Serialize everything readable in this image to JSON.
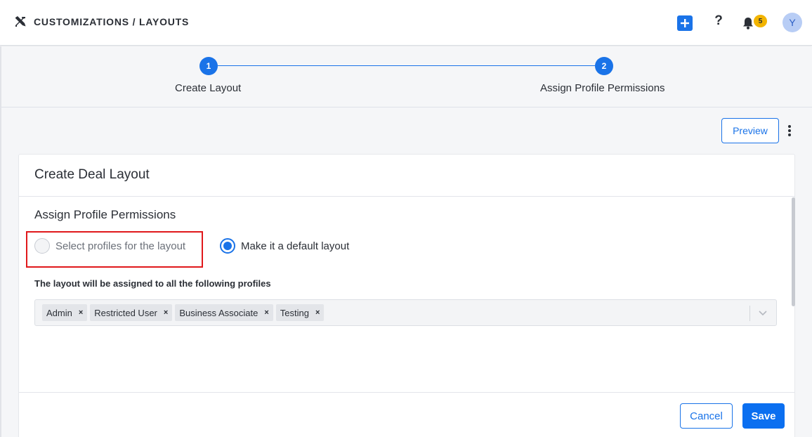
{
  "header": {
    "title": "CUSTOMIZATIONS / LAYOUTS",
    "help_label": "?",
    "notifications_count": "5",
    "avatar_initial": "Y"
  },
  "stepper": {
    "steps": [
      {
        "number": "1",
        "label": "Create Layout"
      },
      {
        "number": "2",
        "label": "Assign Profile Permissions"
      }
    ]
  },
  "toolbar": {
    "preview_label": "Preview"
  },
  "card": {
    "title": "Create Deal Layout",
    "section_title": "Assign Profile Permissions",
    "radio_options": [
      {
        "label": "Select profiles for the layout",
        "checked": false
      },
      {
        "label": "Make it a default layout",
        "checked": true
      }
    ],
    "assign_label": "The layout will be assigned to all the following profiles",
    "profiles": [
      "Admin",
      "Restricted User",
      "Business Associate",
      "Testing"
    ],
    "remove_glyph": "×"
  },
  "footer": {
    "cancel_label": "Cancel",
    "save_label": "Save"
  },
  "colors": {
    "accent": "#1a73e8",
    "highlight_border": "#e0181b",
    "badge": "#f2b400"
  }
}
